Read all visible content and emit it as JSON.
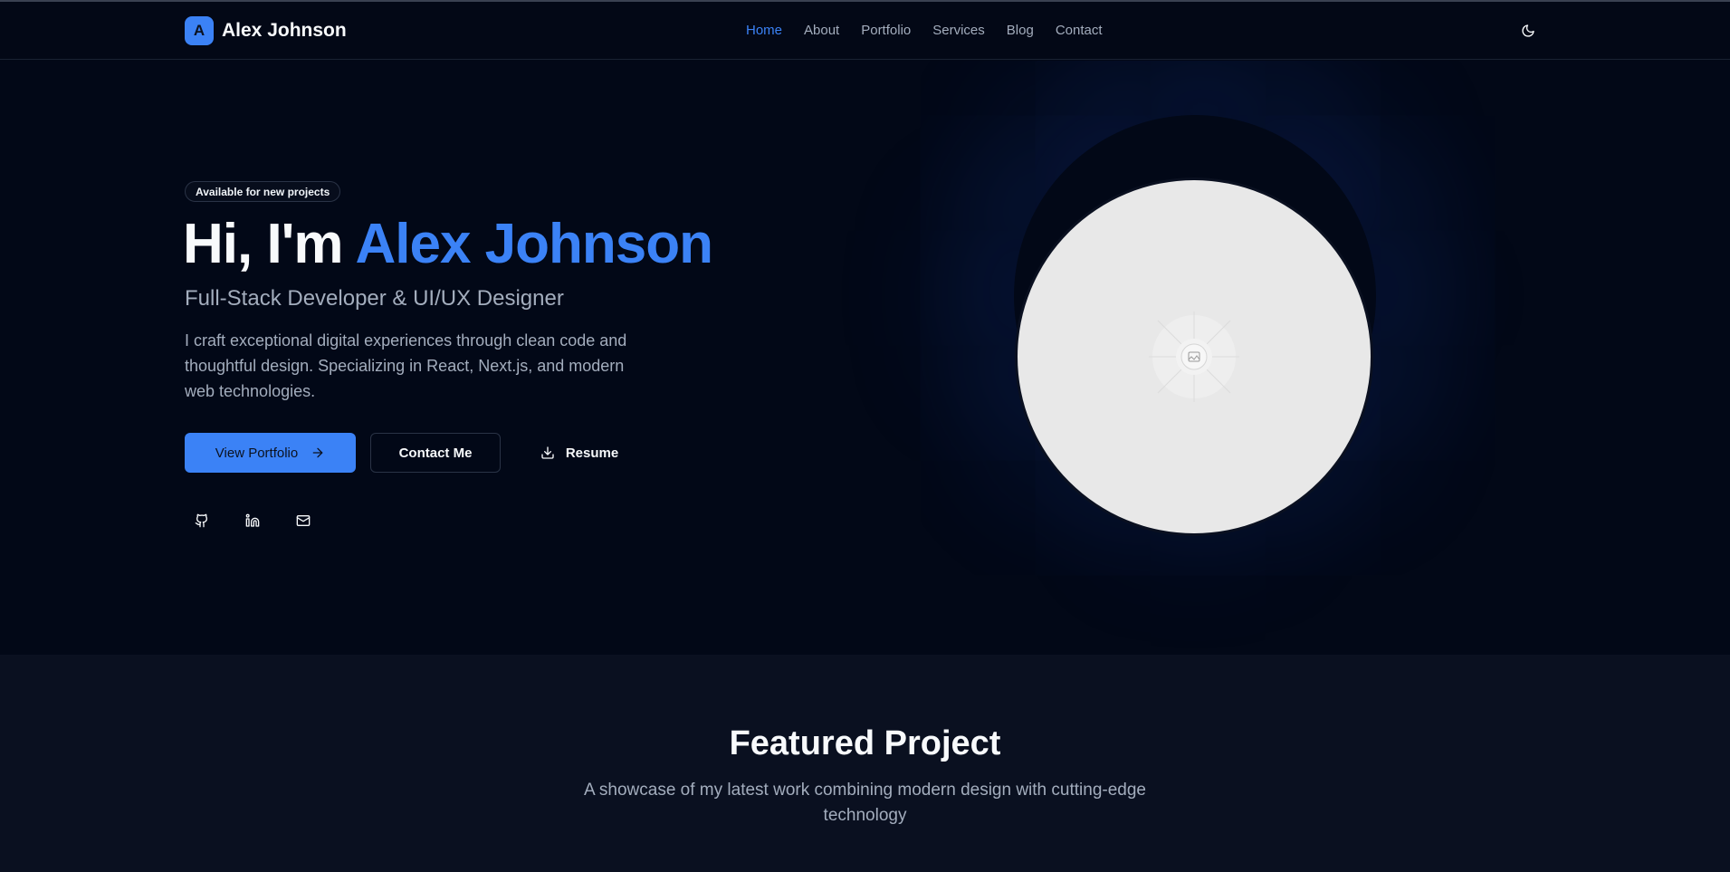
{
  "brand": {
    "badge": "A",
    "name": "Alex Johnson"
  },
  "nav": {
    "items": [
      {
        "label": "Home",
        "active": true
      },
      {
        "label": "About",
        "active": false
      },
      {
        "label": "Portfolio",
        "active": false
      },
      {
        "label": "Services",
        "active": false
      },
      {
        "label": "Blog",
        "active": false
      },
      {
        "label": "Contact",
        "active": false
      }
    ],
    "theme_toggle_icon": "moon-icon"
  },
  "hero": {
    "availability": "Available for new projects",
    "greeting": "Hi, I'm ",
    "name": "Alex Johnson",
    "subtitle": "Full-Stack Developer & UI/UX Designer",
    "description": "I craft exceptional digital experiences through clean code and thoughtful design. Specializing in React, Next.js, and modern web technologies.",
    "buttons": {
      "primary": "View Portfolio",
      "outline": "Contact Me",
      "ghost": "Resume"
    },
    "socials": [
      "github-icon",
      "linkedin-icon",
      "mail-icon"
    ],
    "profile_image_icon": "image-placeholder-icon"
  },
  "featured": {
    "title": "Featured Project",
    "subtitle": "A showcase of my latest work combining modern design with cutting-edge technology"
  },
  "colors": {
    "accent": "#3b82f6",
    "background": "#020817",
    "muted_text": "#a3adbd",
    "section_background": "#0a1020"
  }
}
